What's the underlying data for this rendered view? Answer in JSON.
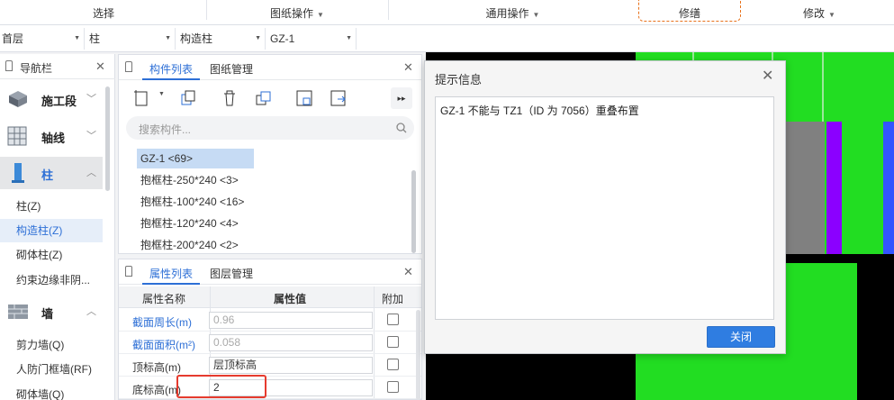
{
  "ribbon": {
    "groups": [
      "选择",
      "图纸操作",
      "通用操作",
      "修缮",
      "修改"
    ]
  },
  "selectors": {
    "floor": "首层",
    "category": "柱",
    "type": "构造柱",
    "component": "GZ-1"
  },
  "navigator": {
    "title": "导航栏",
    "categories": [
      {
        "label": "施工段"
      },
      {
        "label": "轴线"
      },
      {
        "label": "柱"
      },
      {
        "label": "墙"
      }
    ],
    "column_items": [
      "柱(Z)",
      "构造柱(Z)",
      "砌体柱(Z)",
      "约束边缘非阴..."
    ],
    "wall_items": [
      "剪力墙(Q)",
      "人防门框墙(RF)",
      "砌体墙(Q)"
    ]
  },
  "component_panel": {
    "tabs": [
      "构件列表",
      "图纸管理"
    ],
    "search_placeholder": "搜索构件...",
    "items": [
      "GZ-1 <69>",
      "抱框柱-250*240 <3>",
      "抱框柱-100*240 <16>",
      "抱框柱-120*240 <4>",
      "抱框柱-200*240 <2>"
    ]
  },
  "property_panel": {
    "tabs": [
      "属性列表",
      "图层管理"
    ],
    "headers": [
      "属性名称",
      "属性值",
      "附加"
    ],
    "rows": [
      {
        "name": "截面周长(m)",
        "value": "0.96"
      },
      {
        "name": "截面面积(m²)",
        "value": "0.058"
      },
      {
        "name": "顶标高(m)",
        "value": "层顶标高"
      },
      {
        "name": "底标高(m)",
        "value": "2"
      }
    ]
  },
  "dialog": {
    "title": "提示信息",
    "message": "GZ-1 不能与 TZ1（ID 为 7056）重叠布置",
    "close_button": "关闭"
  },
  "colors": {
    "accent": "#2d6fd6",
    "canvas_green": "#22dd22",
    "canvas_gray": "#808080",
    "canvas_purple": "#8b00ff",
    "highlight_red": "#e63b2e"
  }
}
